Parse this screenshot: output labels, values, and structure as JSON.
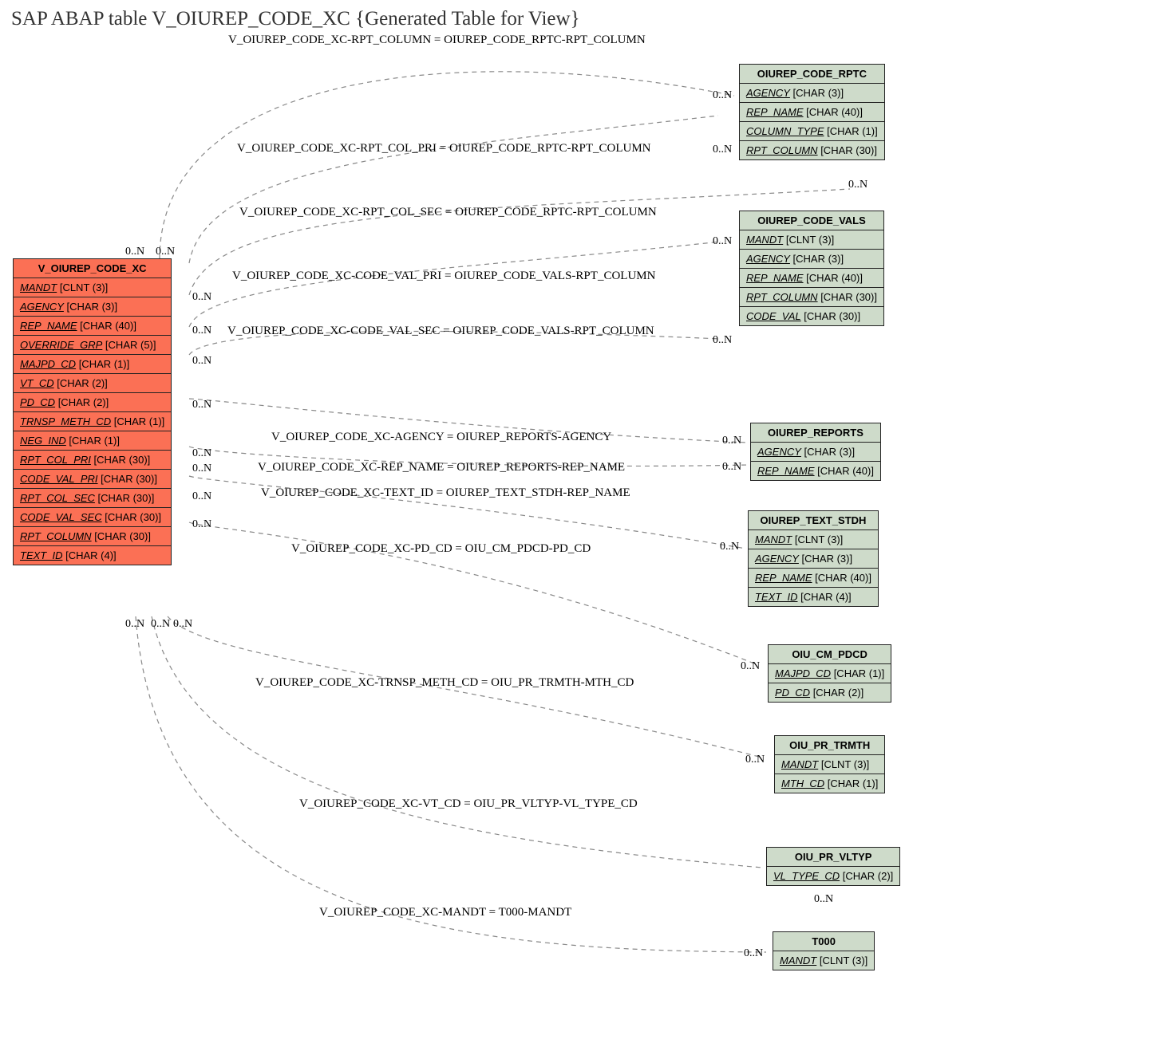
{
  "title": "SAP ABAP table V_OIUREP_CODE_XC {Generated Table for View}",
  "main": {
    "name": "V_OIUREP_CODE_XC",
    "fields": [
      {
        "name": "MANDT",
        "type": "[CLNT (3)]"
      },
      {
        "name": "AGENCY",
        "type": "[CHAR (3)]"
      },
      {
        "name": "REP_NAME",
        "type": "[CHAR (40)]"
      },
      {
        "name": "OVERRIDE_GRP",
        "type": "[CHAR (5)]"
      },
      {
        "name": "MAJPD_CD",
        "type": "[CHAR (1)]"
      },
      {
        "name": "VT_CD",
        "type": "[CHAR (2)]"
      },
      {
        "name": "PD_CD",
        "type": "[CHAR (2)]"
      },
      {
        "name": "TRNSP_METH_CD",
        "type": "[CHAR (1)]"
      },
      {
        "name": "NEG_IND",
        "type": "[CHAR (1)]"
      },
      {
        "name": "RPT_COL_PRI",
        "type": "[CHAR (30)]"
      },
      {
        "name": "CODE_VAL_PRI",
        "type": "[CHAR (30)]"
      },
      {
        "name": "RPT_COL_SEC",
        "type": "[CHAR (30)]"
      },
      {
        "name": "CODE_VAL_SEC",
        "type": "[CHAR (30)]"
      },
      {
        "name": "RPT_COLUMN",
        "type": "[CHAR (30)]"
      },
      {
        "name": "TEXT_ID",
        "type": "[CHAR (4)]"
      }
    ]
  },
  "rels": [
    {
      "label": "V_OIUREP_CODE_XC-RPT_COLUMN = OIUREP_CODE_RPTC-RPT_COLUMN"
    },
    {
      "label": "V_OIUREP_CODE_XC-RPT_COL_PRI = OIUREP_CODE_RPTC-RPT_COLUMN"
    },
    {
      "label": "V_OIUREP_CODE_XC-RPT_COL_SEC = OIUREP_CODE_RPTC-RPT_COLUMN"
    },
    {
      "label": "V_OIUREP_CODE_XC-CODE_VAL_PRI = OIUREP_CODE_VALS-RPT_COLUMN"
    },
    {
      "label": "V_OIUREP_CODE_XC-CODE_VAL_SEC = OIUREP_CODE_VALS-RPT_COLUMN"
    },
    {
      "label": "V_OIUREP_CODE_XC-AGENCY = OIUREP_REPORTS-AGENCY"
    },
    {
      "label": "V_OIUREP_CODE_XC-REP_NAME = OIUREP_REPORTS-REP_NAME"
    },
    {
      "label": "V_OIUREP_CODE_XC-TEXT_ID = OIUREP_TEXT_STDH-REP_NAME"
    },
    {
      "label": "V_OIUREP_CODE_XC-PD_CD = OIU_CM_PDCD-PD_CD"
    },
    {
      "label": "V_OIUREP_CODE_XC-TRNSP_METH_CD = OIU_PR_TRMTH-MTH_CD"
    },
    {
      "label": "V_OIUREP_CODE_XC-VT_CD = OIU_PR_VLTYP-VL_TYPE_CD"
    },
    {
      "label": "V_OIUREP_CODE_XC-MANDT = T000-MANDT"
    }
  ],
  "entities": {
    "rptc": {
      "name": "OIUREP_CODE_RPTC",
      "fields": [
        {
          "name": "AGENCY",
          "type": "[CHAR (3)]"
        },
        {
          "name": "REP_NAME",
          "type": "[CHAR (40)]"
        },
        {
          "name": "COLUMN_TYPE",
          "type": "[CHAR (1)]"
        },
        {
          "name": "RPT_COLUMN",
          "type": "[CHAR (30)]"
        }
      ]
    },
    "vals": {
      "name": "OIUREP_CODE_VALS",
      "fields": [
        {
          "name": "MANDT",
          "type": "[CLNT (3)]"
        },
        {
          "name": "AGENCY",
          "type": "[CHAR (3)]"
        },
        {
          "name": "REP_NAME",
          "type": "[CHAR (40)]"
        },
        {
          "name": "RPT_COLUMN",
          "type": "[CHAR (30)]"
        },
        {
          "name": "CODE_VAL",
          "type": "[CHAR (30)]"
        }
      ]
    },
    "reports": {
      "name": "OIUREP_REPORTS",
      "fields": [
        {
          "name": "AGENCY",
          "type": "[CHAR (3)]"
        },
        {
          "name": "REP_NAME",
          "type": "[CHAR (40)]"
        }
      ]
    },
    "stdh": {
      "name": "OIUREP_TEXT_STDH",
      "fields": [
        {
          "name": "MANDT",
          "type": "[CLNT (3)]"
        },
        {
          "name": "AGENCY",
          "type": "[CHAR (3)]"
        },
        {
          "name": "REP_NAME",
          "type": "[CHAR (40)]"
        },
        {
          "name": "TEXT_ID",
          "type": "[CHAR (4)]"
        }
      ]
    },
    "pdcd": {
      "name": "OIU_CM_PDCD",
      "fields": [
        {
          "name": "MAJPD_CD",
          "type": "[CHAR (1)]"
        },
        {
          "name": "PD_CD",
          "type": "[CHAR (2)]"
        }
      ]
    },
    "trmth": {
      "name": "OIU_PR_TRMTH",
      "fields": [
        {
          "name": "MANDT",
          "type": "[CLNT (3)]"
        },
        {
          "name": "MTH_CD",
          "type": "[CHAR (1)]"
        }
      ]
    },
    "vltyp": {
      "name": "OIU_PR_VLTYP",
      "fields": [
        {
          "name": "VL_TYPE_CD",
          "type": "[CHAR (2)]"
        }
      ]
    },
    "t000": {
      "name": "T000",
      "fields": [
        {
          "name": "MANDT",
          "type": "[CLNT (3)]"
        }
      ]
    }
  },
  "card": "0..N"
}
